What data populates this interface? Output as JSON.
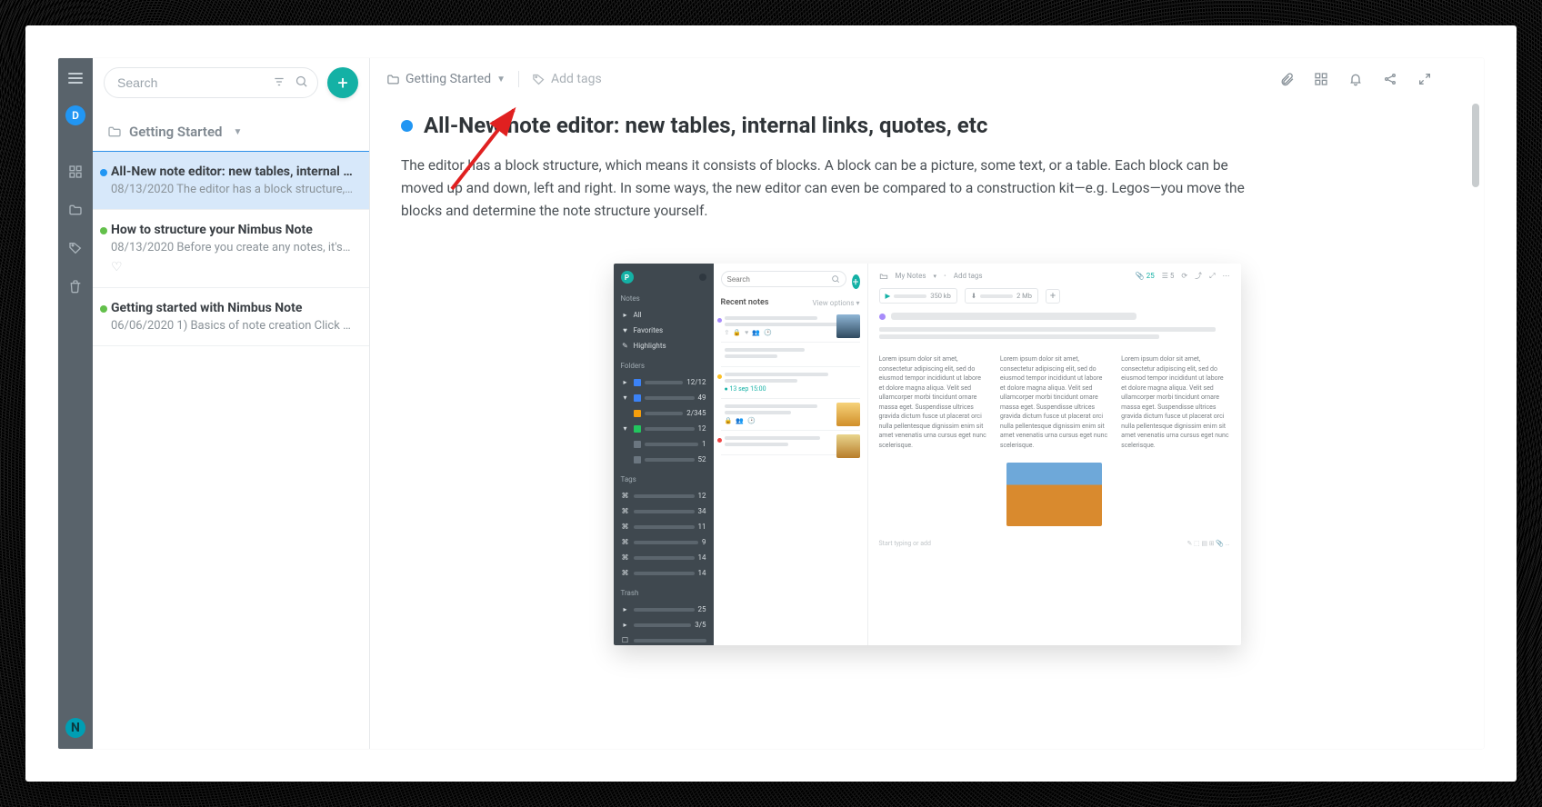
{
  "rail": {
    "avatar_initial": "D",
    "logo_initial": "N"
  },
  "sidebar": {
    "search_placeholder": "Search",
    "folder_label": "Getting Started",
    "notes": [
      {
        "dot": "#2196f3",
        "title": "All-New note editor: new tables, internal lin...",
        "meta": "08/13/2020 The editor has a block structure, whic...",
        "active": true,
        "favorite": false
      },
      {
        "dot": "#63c04b",
        "title": "How to structure your Nimbus Note",
        "meta": "08/13/2020 Before you create any notes, it's wort...",
        "active": false,
        "favorite": true
      },
      {
        "dot": "#63c04b",
        "title": "Getting started with Nimbus Note",
        "meta": "06/06/2020 1) Basics of note creation Click on the...",
        "active": false,
        "favorite": false
      }
    ]
  },
  "topbar": {
    "breadcrumb_folder": "Getting Started",
    "add_tags_label": "Add tags"
  },
  "note": {
    "title": "All-New note editor: new tables, internal links, quotes, etc",
    "body": "The editor has a block structure, which means it consists of blocks. A block can be a picture, some text, or a table. Each block can be moved up and down, left and right. In some ways, the new editor can even be compared to a construction kit—e.g. Legos—you move the blocks and determine the note structure yourself."
  },
  "embedded": {
    "search_placeholder": "Search",
    "sidebar_labels": {
      "notes": "Notes",
      "all": "All",
      "fav": "Favorites",
      "hl": "Highlights",
      "folders": "Folders",
      "tags": "Tags",
      "trash": "Trash"
    },
    "folder_counts": [
      "12/12",
      "49",
      "2/345",
      "12",
      "1",
      "52"
    ],
    "tag_counts": [
      "12",
      "34",
      "11",
      "9",
      "14",
      "14"
    ],
    "trash_counts": [
      "25",
      "3/5"
    ],
    "mid": {
      "recent_label": "Recent notes",
      "view_options": "View options  ▾",
      "date_label": "13 sep 15:00"
    },
    "right": {
      "breadcrumb": "My Notes",
      "add_tags": "Add tags",
      "badge_25": "25",
      "badge_5": "5",
      "att1": "350 kb",
      "att2": "2 Mb",
      "footer_hint": "Start typing or add"
    },
    "lorem": "Lorem ipsum dolor sit amet, consectetur adipiscing elit, sed do eiusmod tempor incididunt ut labore et dolore magna aliqua. Velit sed ullamcorper morbi tincidunt ornare massa eget. Suspendisse ultrices gravida dictum fusce ut placerat orci nulla pellentesque dignissim enim sit amet venenatis urna cursus eget nunc scelerisque."
  }
}
